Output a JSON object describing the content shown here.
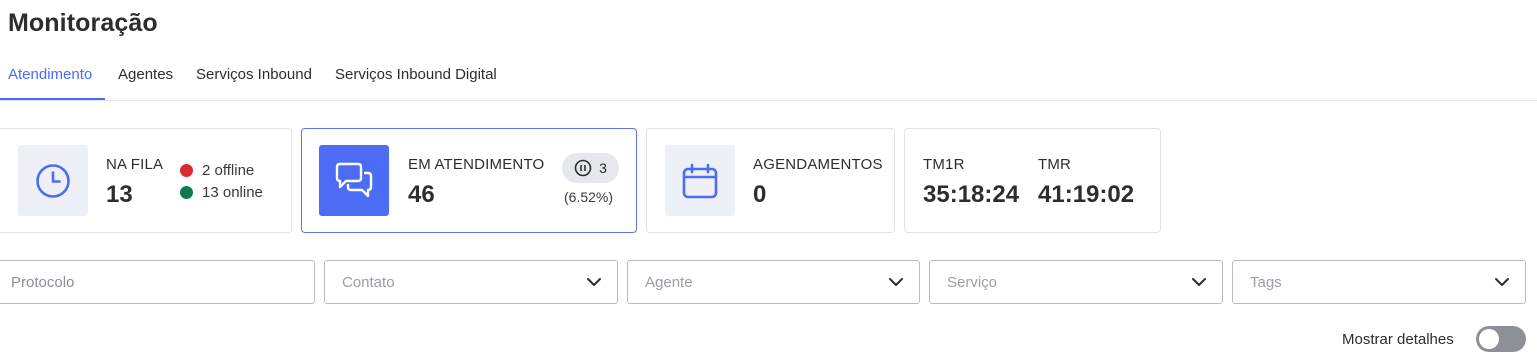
{
  "page": {
    "title": "Monitoração"
  },
  "tabs": [
    {
      "label": "Atendimento",
      "active": true
    },
    {
      "label": "Agentes",
      "active": false
    },
    {
      "label": "Serviços Inbound",
      "active": false
    },
    {
      "label": "Serviços Inbound Digital",
      "active": false
    }
  ],
  "cards": {
    "queue": {
      "icon": "clock-icon",
      "label": "NA FILA",
      "value": "13",
      "offline": "2 offline",
      "online": "13 online",
      "offline_color": "#dc2b2b",
      "online_color": "#0f7a4f"
    },
    "in_service": {
      "icon": "chat-bubbles-icon",
      "label": "EM ATENDIMENTO",
      "value": "46",
      "paused_icon": "pause-circle-icon",
      "paused_count": "3",
      "paused_percent": "(6.52%)",
      "selected": true
    },
    "scheduled": {
      "icon": "calendar-icon",
      "label": "AGENDAMENTOS",
      "value": "0"
    },
    "times": {
      "tm1r_label": "TM1R",
      "tm1r_value": "35:18:24",
      "tmr_label": "TMR",
      "tmr_value": "41:19:02"
    }
  },
  "filters": {
    "protocolo_placeholder": "Protocolo",
    "contato_placeholder": "Contato",
    "agente_placeholder": "Agente",
    "servico_placeholder": "Serviço",
    "tags_placeholder": "Tags"
  },
  "details_toggle": {
    "label": "Mostrar detalhes",
    "checked": false
  },
  "colors": {
    "accent": "#4a6cf7",
    "icon_bg": "#eef0f8",
    "toggle_off": "#8e9097"
  }
}
